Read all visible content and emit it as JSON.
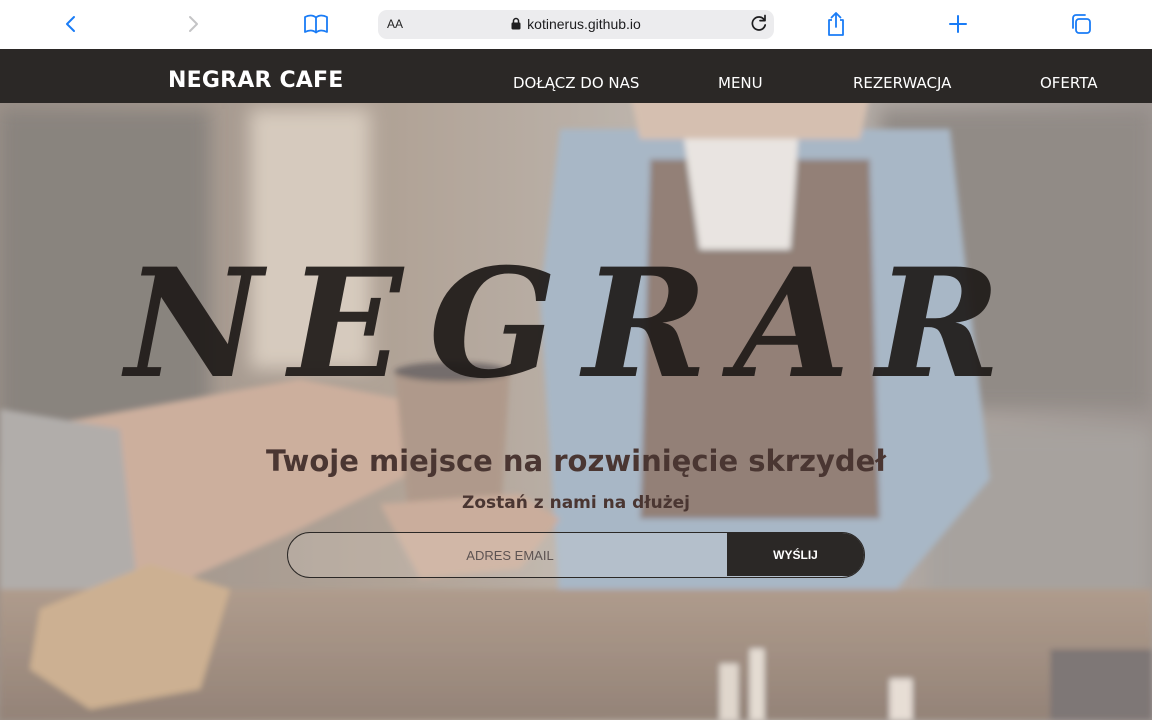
{
  "browser": {
    "reader_label": "AA",
    "url": "kotinerus.github.io",
    "icons": [
      "back-icon",
      "forward-icon",
      "bookmarks-icon",
      "lock-icon",
      "reload-icon",
      "share-icon",
      "new-tab-icon",
      "tabs-icon"
    ],
    "accent": "#1a7cf6"
  },
  "nav": {
    "brand": "NEGRAR CAFE",
    "links": [
      "DOŁĄCZ DO NAS",
      "MENU",
      "REZERWACJA",
      "OFERTA"
    ],
    "background": "#2b2826"
  },
  "hero": {
    "title": "NEGRAR",
    "subtitle": "Twoje miejsce na rozwinięcie skrzydeł",
    "tagline": "Zostań z nami na dłużej"
  },
  "newsletter": {
    "placeholder": "ADRES EMAIL",
    "button_label": "WYŚLIJ"
  }
}
